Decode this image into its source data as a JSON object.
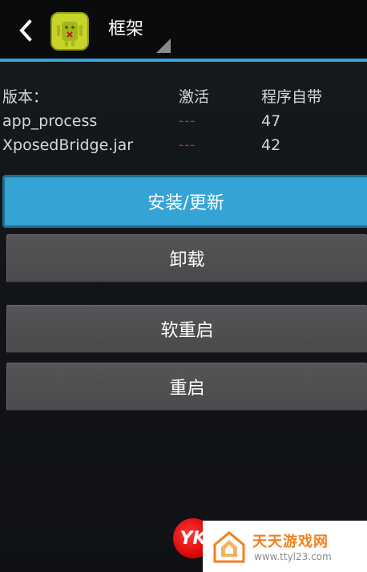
{
  "header": {
    "title": "框架",
    "back_icon": "back-chevron-icon",
    "app_icon": "xposed-android-icon"
  },
  "versions": {
    "header": [
      "版本：",
      "激活",
      "程序自带"
    ],
    "rows": [
      {
        "name": "app_process",
        "active": "---",
        "bundled": "47"
      },
      {
        "name": "XposedBridge.jar",
        "active": "---",
        "bundled": "42"
      }
    ]
  },
  "buttons": {
    "install": "安装/更新",
    "uninstall": "卸载",
    "soft_reboot": "软重启",
    "reboot": "重启"
  },
  "watermark": {
    "logo_text": "YK",
    "name": "天天游戏网",
    "url": "www.ttyl23.com"
  },
  "colors": {
    "accent": "#35a3d4",
    "danger": "#e02020",
    "button_gray": "#4e4e50"
  }
}
